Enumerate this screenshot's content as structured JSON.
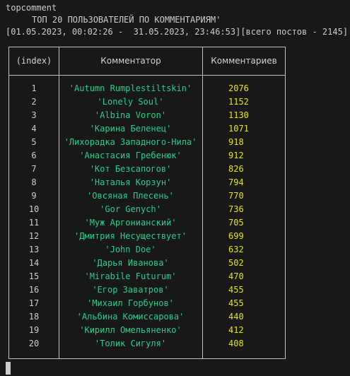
{
  "terminal": {
    "command": "topcomment",
    "heading": "ТОП 20 ПОЛЬЗОВАТЕЛЕЙ ПО КОММЕНТАРИЯМ'",
    "range": "[01.05.2023, 00:02:26 -  31.05.2023, 23:46:53][всего постов - 2145]"
  },
  "table": {
    "headers": {
      "index": "(index)",
      "user": "Комментатор",
      "count": "Комментариев"
    },
    "rows": [
      {
        "index": "1",
        "user": "'Autumn Rumplestiltskin'",
        "count": "2076"
      },
      {
        "index": "2",
        "user": "'Lonely Soul'",
        "count": "1152"
      },
      {
        "index": "3",
        "user": "'Albina Voron'",
        "count": "1130"
      },
      {
        "index": "4",
        "user": "'Карина Беленец'",
        "count": "1071"
      },
      {
        "index": "5",
        "user": "'Лихорадка Западного-Нила'",
        "count": "918"
      },
      {
        "index": "6",
        "user": "'Анастасия Гребенюк'",
        "count": "912"
      },
      {
        "index": "7",
        "user": "'Кот Безсапогов'",
        "count": "826"
      },
      {
        "index": "8",
        "user": "'Наталья Корзун'",
        "count": "794"
      },
      {
        "index": "9",
        "user": "'Овсяная Плесень'",
        "count": "770"
      },
      {
        "index": "10",
        "user": "'Gor Genych'",
        "count": "736"
      },
      {
        "index": "11",
        "user": "'Муж Аргонианский'",
        "count": "705"
      },
      {
        "index": "12",
        "user": "'Дмитрия Несуществует'",
        "count": "699"
      },
      {
        "index": "13",
        "user": "'John Doe'",
        "count": "632"
      },
      {
        "index": "14",
        "user": "'Дарья Иванова'",
        "count": "502"
      },
      {
        "index": "15",
        "user": "'Mirabile Futurum'",
        "count": "470"
      },
      {
        "index": "16",
        "user": "'Егор Заватров'",
        "count": "455"
      },
      {
        "index": "17",
        "user": "'Михаил Горбунов'",
        "count": "455"
      },
      {
        "index": "18",
        "user": "'Альбина Комиссарова'",
        "count": "440"
      },
      {
        "index": "19",
        "user": "'Кирилл Омельяненко'",
        "count": "412"
      },
      {
        "index": "20",
        "user": "'Толик Сигуля'",
        "count": "408"
      }
    ]
  },
  "colors": {
    "background": "#181818",
    "text": "#cccccc",
    "username": "#23d18b",
    "count": "#e5e510",
    "border": "#bfbfbf"
  }
}
